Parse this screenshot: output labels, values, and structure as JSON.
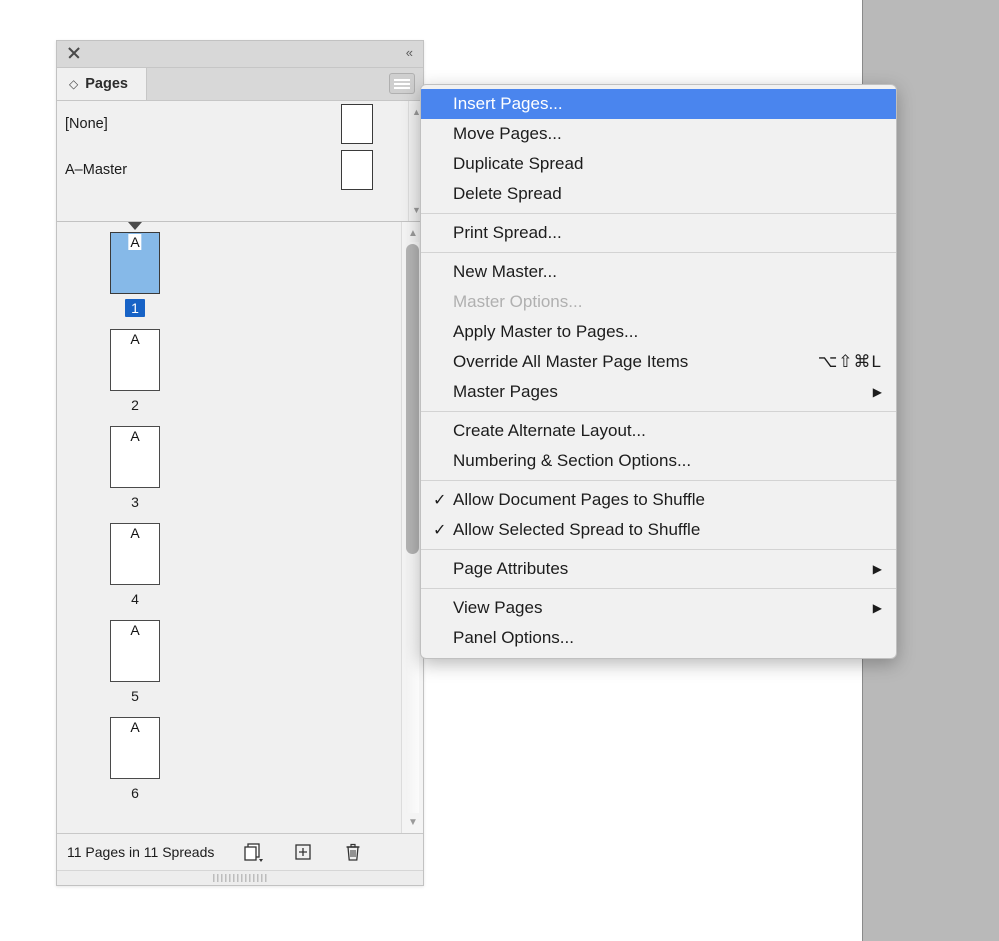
{
  "panel": {
    "close_icon": "close-x",
    "collapse_label": "«",
    "tab": {
      "lozenge": "◇",
      "label": "Pages"
    },
    "menu_button_icon": "hamburger-icon",
    "masters": [
      {
        "name": "[None]"
      },
      {
        "name": "A–Master"
      }
    ],
    "pages": [
      {
        "number": "1",
        "master": "A",
        "selected": true
      },
      {
        "number": "2",
        "master": "A",
        "selected": false
      },
      {
        "number": "3",
        "master": "A",
        "selected": false
      },
      {
        "number": "4",
        "master": "A",
        "selected": false
      },
      {
        "number": "5",
        "master": "A",
        "selected": false
      },
      {
        "number": "6",
        "master": "A",
        "selected": false
      }
    ],
    "footer": {
      "count_text": "11 Pages in 11 Spreads",
      "edit_page_size_icon": "edit-page-size-icon",
      "new_page_icon": "new-page-icon",
      "delete_icon": "trash-icon"
    }
  },
  "context_menu": {
    "groups": [
      {
        "items": [
          {
            "label": "Insert Pages...",
            "highlighted": true,
            "disabled": false,
            "checked": false,
            "submenu": false,
            "shortcut": ""
          },
          {
            "label": "Move Pages...",
            "highlighted": false,
            "disabled": false,
            "checked": false,
            "submenu": false,
            "shortcut": ""
          },
          {
            "label": "Duplicate Spread",
            "highlighted": false,
            "disabled": false,
            "checked": false,
            "submenu": false,
            "shortcut": ""
          },
          {
            "label": "Delete Spread",
            "highlighted": false,
            "disabled": false,
            "checked": false,
            "submenu": false,
            "shortcut": ""
          }
        ]
      },
      {
        "items": [
          {
            "label": "Print Spread...",
            "highlighted": false,
            "disabled": false,
            "checked": false,
            "submenu": false,
            "shortcut": ""
          }
        ]
      },
      {
        "items": [
          {
            "label": "New Master...",
            "highlighted": false,
            "disabled": false,
            "checked": false,
            "submenu": false,
            "shortcut": ""
          },
          {
            "label": "Master Options...",
            "highlighted": false,
            "disabled": true,
            "checked": false,
            "submenu": false,
            "shortcut": ""
          },
          {
            "label": "Apply Master to Pages...",
            "highlighted": false,
            "disabled": false,
            "checked": false,
            "submenu": false,
            "shortcut": ""
          },
          {
            "label": "Override All Master Page Items",
            "highlighted": false,
            "disabled": false,
            "checked": false,
            "submenu": false,
            "shortcut": "⌥⇧⌘L"
          },
          {
            "label": "Master Pages",
            "highlighted": false,
            "disabled": false,
            "checked": false,
            "submenu": true,
            "shortcut": ""
          }
        ]
      },
      {
        "items": [
          {
            "label": "Create Alternate Layout...",
            "highlighted": false,
            "disabled": false,
            "checked": false,
            "submenu": false,
            "shortcut": ""
          },
          {
            "label": "Numbering & Section Options...",
            "highlighted": false,
            "disabled": false,
            "checked": false,
            "submenu": false,
            "shortcut": ""
          }
        ]
      },
      {
        "items": [
          {
            "label": "Allow Document Pages to Shuffle",
            "highlighted": false,
            "disabled": false,
            "checked": true,
            "submenu": false,
            "shortcut": ""
          },
          {
            "label": "Allow Selected Spread to Shuffle",
            "highlighted": false,
            "disabled": false,
            "checked": true,
            "submenu": false,
            "shortcut": ""
          }
        ]
      },
      {
        "items": [
          {
            "label": "Page Attributes",
            "highlighted": false,
            "disabled": false,
            "checked": false,
            "submenu": true,
            "shortcut": ""
          }
        ]
      },
      {
        "items": [
          {
            "label": "View Pages",
            "highlighted": false,
            "disabled": false,
            "checked": false,
            "submenu": true,
            "shortcut": ""
          },
          {
            "label": "Panel Options...",
            "highlighted": false,
            "disabled": false,
            "checked": false,
            "submenu": false,
            "shortcut": ""
          }
        ]
      }
    ],
    "check_glyph": "✓",
    "submenu_glyph": "▶"
  },
  "colors": {
    "highlight": "#4a85ee",
    "page_selected": "#86b9e8",
    "page_number_selected_bg": "#1763c6",
    "panel_bg": "#f0f0f0",
    "desktop_gray": "#b9b9b9"
  }
}
